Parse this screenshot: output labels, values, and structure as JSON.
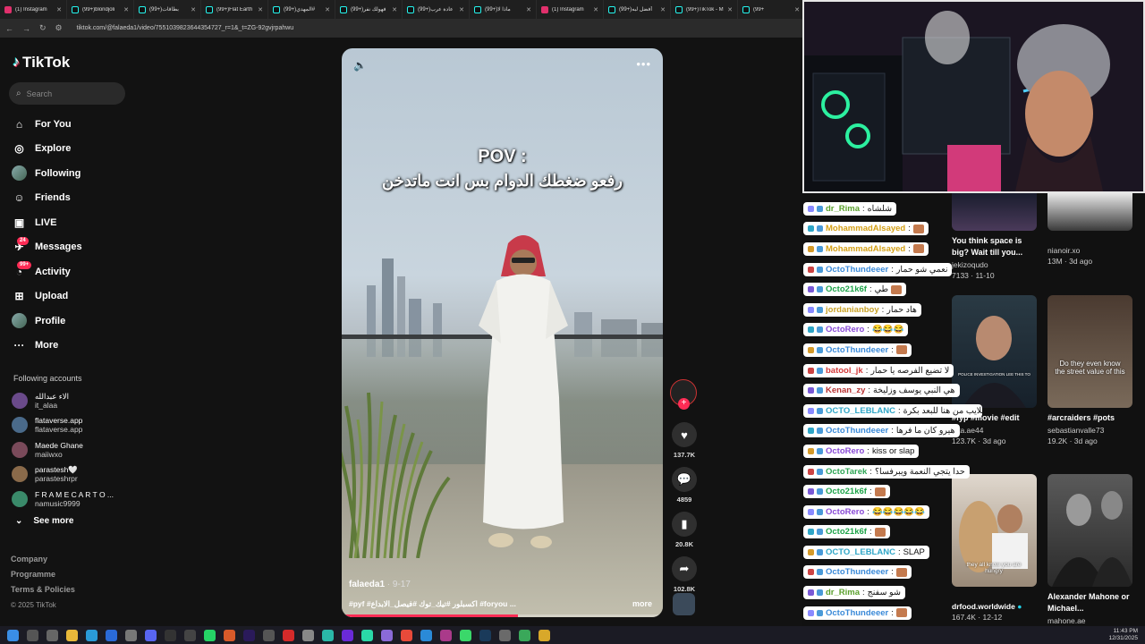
{
  "browser": {
    "tabs": [
      {
        "label": "(1) Instagram",
        "fav": "ig"
      },
      {
        "label": "(99+)blondjoli",
        "fav": "tt"
      },
      {
        "label": "(99+)بطاقات",
        "fav": "tt"
      },
      {
        "label": "(99+)Flat Earth",
        "fav": "tt"
      },
      {
        "label": "(99+)المهدي#",
        "fav": "tt"
      },
      {
        "label": "(99+)فهولك نفر",
        "fav": "tt"
      },
      {
        "label": "(99+)عادة عرب",
        "fav": "tt"
      },
      {
        "label": "(99+)ماذا لا",
        "fav": "tt"
      },
      {
        "label": "(1) Instagram",
        "fav": "ig"
      },
      {
        "label": "(99+)أفضل لبه",
        "fav": "tt"
      },
      {
        "label": "(99+)TikTok - M",
        "fav": "tt"
      },
      {
        "label": "(99+",
        "fav": "tt"
      }
    ],
    "url": "tiktok.com/@falaeda1/video/7551039823644354727_r=1&_t=ZG-92gvjrpahwu"
  },
  "sidebar": {
    "logo": "TikTok",
    "search_placeholder": "Search",
    "menu": [
      {
        "label": "For You",
        "icon": "home-icon",
        "glyph": "⌂"
      },
      {
        "label": "Explore",
        "icon": "compass-icon",
        "glyph": "◎"
      },
      {
        "label": "Following",
        "icon": "following-avatar-icon",
        "glyph": "●"
      },
      {
        "label": "Friends",
        "icon": "friends-icon",
        "glyph": "☺"
      },
      {
        "label": "LIVE",
        "icon": "live-icon",
        "glyph": "▣"
      },
      {
        "label": "Messages",
        "icon": "messages-icon",
        "glyph": "✈",
        "badge": "24"
      },
      {
        "label": "Activity",
        "icon": "activity-icon",
        "glyph": "◔",
        "badge": "99+"
      },
      {
        "label": "Upload",
        "icon": "upload-icon",
        "glyph": "⊞"
      },
      {
        "label": "Profile",
        "icon": "profile-avatar-icon",
        "glyph": "●"
      },
      {
        "label": "More",
        "icon": "more-icon",
        "glyph": "···"
      }
    ],
    "following_title": "Following accounts",
    "following": [
      {
        "name": "الاء عبدالله",
        "handle": "it_alaa"
      },
      {
        "name": "flataverse.app",
        "handle": "flataverse.app"
      },
      {
        "name": "Maede Ghane",
        "handle": "maiiwxo"
      },
      {
        "name": "parastesh🤍",
        "handle": "parasteshrpr"
      },
      {
        "name": "F R A M E C A R T O ...",
        "handle": "namusic9999"
      }
    ],
    "see_more": "See more",
    "footer": [
      "Company",
      "Programme",
      "Terms & Policies"
    ],
    "copyright": "© 2025 TikTok"
  },
  "video": {
    "overlay_title": "POV :",
    "overlay_subtitle": "رفعو ضغطك الدوام بس انت ماتدخن",
    "author": "falaeda1",
    "date": " · 9-17",
    "caption": "#pyf #اكسبلور #تيك_توك #فيصل_الابداع #foryou ...",
    "more_label": "more",
    "progress": 0.55
  },
  "actions": {
    "likes": "137.7K",
    "comments": "4859",
    "saves": "20.8K",
    "shares": "102.8K"
  },
  "chat": [
    {
      "user": "dr_Rima",
      "color": "#5aa02c",
      "text": "شلشاه",
      "emote": false
    },
    {
      "user": "MohammadAlsayed",
      "color": "#d4a017",
      "text": "",
      "emote": true
    },
    {
      "user": "MohammadAlsayed",
      "color": "#d4a017",
      "text": "",
      "emote": true
    },
    {
      "user": "OctoThundeeer",
      "color": "#3b8ad8",
      "text": "نعمي شو حمار",
      "emote": false
    },
    {
      "user": "Octo21k6f",
      "color": "#1fa44a",
      "text": "طي",
      "emote": true
    },
    {
      "user": "jordanianboy",
      "color": "#c9a227",
      "text": "هاد حمار",
      "emote": false
    },
    {
      "user": "OctoRero",
      "color": "#8a4bd6",
      "text": "😂😂😂",
      "emote": false
    },
    {
      "user": "OctoThundeeer",
      "color": "#3b8ad8",
      "text": "",
      "emote": true
    },
    {
      "user": "batool_jk",
      "color": "#d43a3a",
      "text": "لا تضيع الفرصه يا حمار",
      "emote": false
    },
    {
      "user": "Kenan_zy",
      "color": "#b83232",
      "text": "هي النبي يوسف وزليخة",
      "emote": false
    },
    {
      "user": "OCTO_LEBLANC",
      "color": "#2fa6c7",
      "text": "سلايب من هنا للبعد بكرة",
      "emote": false
    },
    {
      "user": "OctoThundeeer",
      "color": "#3b8ad8",
      "text": "هيرو كان ما فرها",
      "emote": false
    },
    {
      "user": "OctoRero",
      "color": "#8a4bd6",
      "text": "kiss or slap",
      "emote": false
    },
    {
      "user": "OctoTarek",
      "color": "#2fa655",
      "text": "حدا يتجي النعمة ويبرفسا؟",
      "emote": false
    },
    {
      "user": "Octo21k6f",
      "color": "#1fa44a",
      "text": "",
      "emote": true
    },
    {
      "user": "OctoRero",
      "color": "#8a4bd6",
      "text": "😂😂😂😂😂",
      "emote": false
    },
    {
      "user": "Octo21k6f",
      "color": "#1fa44a",
      "text": "",
      "emote": true
    },
    {
      "user": "OCTO_LEBLANC",
      "color": "#2fa6c7",
      "text": "SLAP",
      "emote": false
    },
    {
      "user": "OctoThundeeer",
      "color": "#3b8ad8",
      "text": "",
      "emote": true
    },
    {
      "user": "dr_Rima",
      "color": "#5aa02c",
      "text": "شو سفنج",
      "emote": false
    },
    {
      "user": "OctoThundeeer",
      "color": "#3b8ad8",
      "text": "",
      "emote": true
    },
    {
      "user": "OctoThundeeer",
      "color": "#3b8ad8",
      "text": "",
      "emote": true
    }
  ],
  "recs": [
    {
      "title": "You think space is big? Wait till you...",
      "author": "jekizoqudo",
      "stats": "7133 · 11-10",
      "overlay": ""
    },
    {
      "title": "",
      "author": "nianoir.xo",
      "stats": "13M · 3d ago",
      "overlay": ""
    },
    {
      "title": "#fyp #movie #edit",
      "author": "tata.ae44",
      "stats": "123.7K · 3d ago",
      "overlay": "POLICE INVESTIGATION LEE THIS TO"
    },
    {
      "title": "#arcraiders #pots",
      "author": "sebastianvalle73",
      "stats": "19.2K · 3d ago",
      "overlay": "Do they even know the street value of this"
    },
    {
      "title": "",
      "author": "drfood.worldwide",
      "stats": "167.4K · 12-12",
      "overlay": "they all know you are hungry"
    },
    {
      "title": "Alexander Mahone or Michael...",
      "author": "mahone.ae",
      "stats": "",
      "overlay": ""
    }
  ],
  "taskbar": {
    "time": "11:43 PM",
    "date": "12/31/2025"
  }
}
